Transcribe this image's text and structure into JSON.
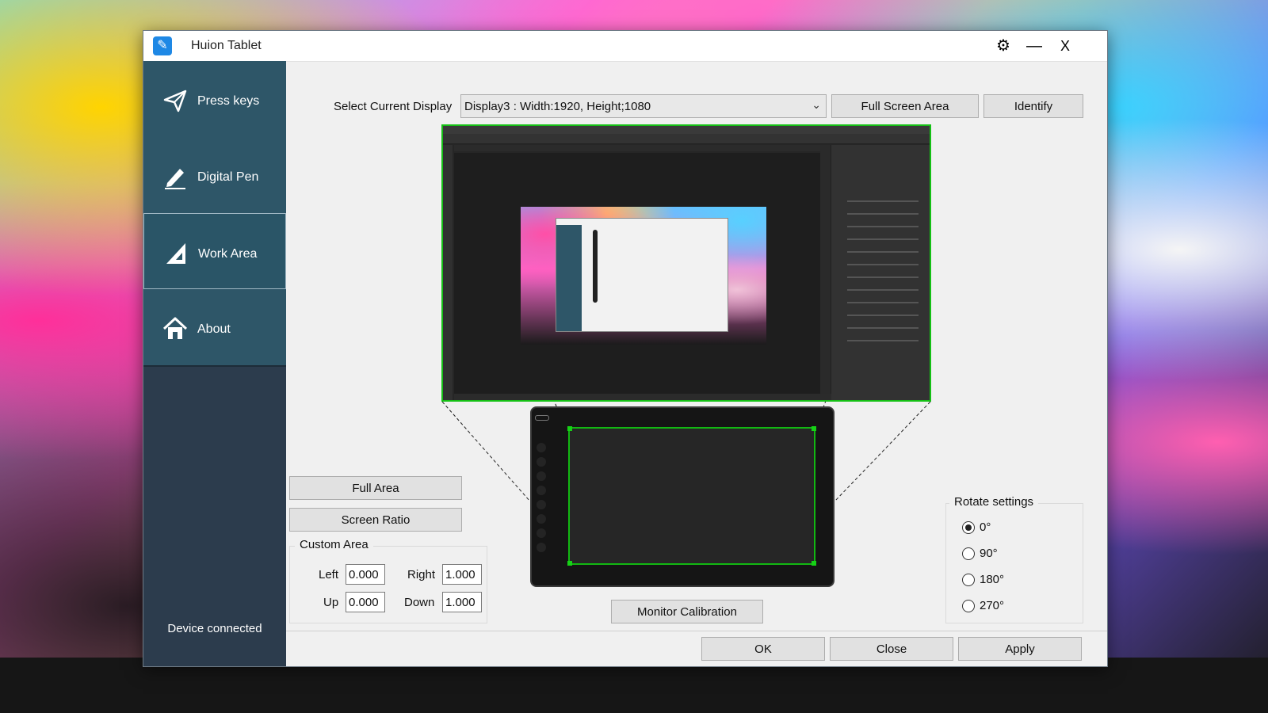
{
  "window": {
    "title": "Huion Tablet"
  },
  "titlebar": {
    "settings_icon": "gear-icon",
    "minimize_glyph": "—",
    "close_glyph": "X"
  },
  "sidebar": {
    "items": [
      {
        "label": "Press keys",
        "icon": "paper-plane-icon"
      },
      {
        "label": "Digital Pen",
        "icon": "pen-icon"
      },
      {
        "label": "Work Area",
        "icon": "triangle-ruler-icon",
        "active": true
      },
      {
        "label": "About",
        "icon": "home-icon"
      }
    ],
    "status": "Device connected"
  },
  "display": {
    "label": "Select Current Display",
    "selected": "Display3 : Width:1920, Height;1080",
    "full_screen_button": "Full Screen Area",
    "identify_button": "Identify"
  },
  "area": {
    "full_area_button": "Full Area",
    "screen_ratio_button": "Screen Ratio",
    "custom_title": "Custom Area",
    "left_label": "Left",
    "left_value": "0.000",
    "right_label": "Right",
    "right_value": "1.000",
    "up_label": "Up",
    "up_value": "0.000",
    "down_label": "Down",
    "down_value": "1.000"
  },
  "calibration_button": "Monitor Calibration",
  "rotate": {
    "title": "Rotate settings",
    "options": [
      "0°",
      "90°",
      "180°",
      "270°"
    ],
    "selected_index": 0
  },
  "footer": {
    "ok": "OK",
    "close": "Close",
    "apply": "Apply"
  },
  "colors": {
    "sidebar_item": "#2e5668",
    "highlight": "#15c015",
    "dialog_bg": "#f0f0f0"
  }
}
